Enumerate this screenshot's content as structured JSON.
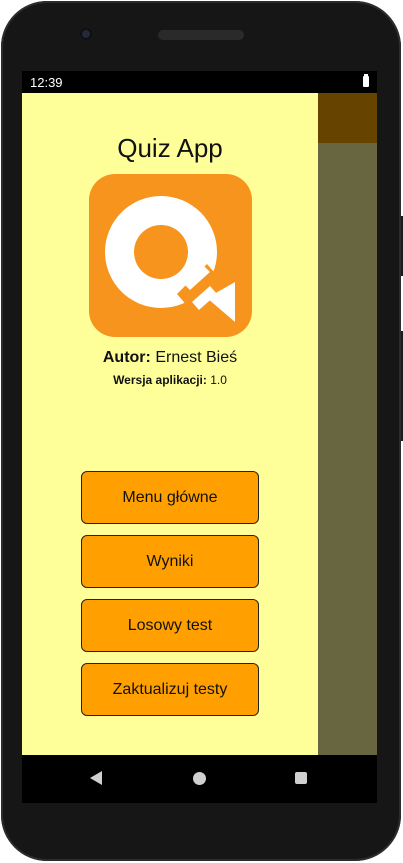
{
  "status_bar": {
    "time": "12:39"
  },
  "drawer": {
    "title": "Quiz App",
    "author_label": "Autor:",
    "author_name": "Ernest Bieś",
    "version_label": "Wersja aplikacji:",
    "version_value": "1.0",
    "menu": [
      {
        "label": "Menu główne"
      },
      {
        "label": "Wyniki"
      },
      {
        "label": "Losowy test"
      },
      {
        "label": "Zaktualizuj testy"
      }
    ]
  },
  "colors": {
    "drawer_background": "#ffff99",
    "button_background": "#ffa000",
    "toolbar": "#664400",
    "scrim_content": "#676640",
    "logo_orange": "#f7941d"
  },
  "icons": {
    "logo": "quiz-q-logo",
    "battery": "battery-icon",
    "nav": [
      "back-icon",
      "home-icon",
      "recents-icon"
    ]
  }
}
